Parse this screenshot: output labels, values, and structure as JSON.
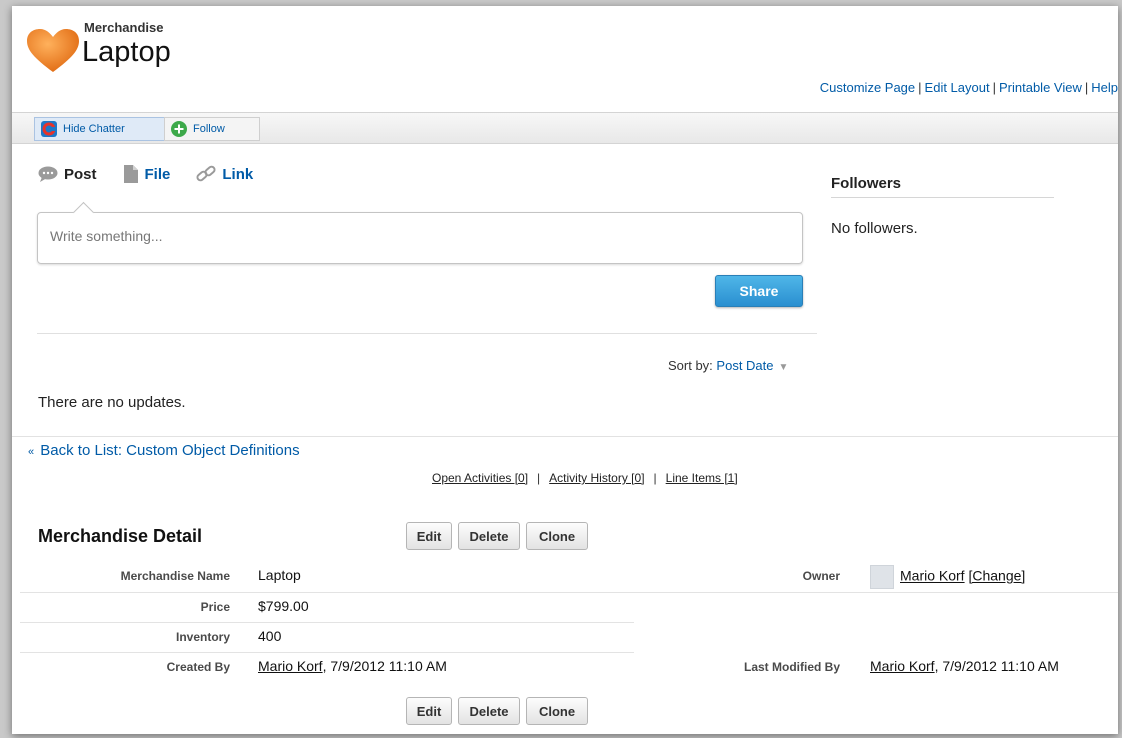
{
  "header": {
    "object_type": "Merchandise",
    "record_name": "Laptop",
    "links": [
      "Customize Page",
      "Edit Layout",
      "Printable View",
      "Help"
    ],
    "accent": "#f0892e"
  },
  "chatter": {
    "hide_label": "Hide Chatter",
    "follow_label": "Follow",
    "publisher_tabs": [
      {
        "label": "Post",
        "icon": "speech-bubble-icon"
      },
      {
        "label": "File",
        "icon": "document-icon"
      },
      {
        "label": "Link",
        "icon": "link-icon"
      }
    ],
    "input_placeholder": "Write something...",
    "share_label": "Share",
    "sort_prefix": "Sort by:",
    "sort_value": "Post Date",
    "no_updates": "There are no updates.",
    "followers_title": "Followers",
    "followers_empty": "No followers."
  },
  "nav": {
    "back_link": "Back to List: Custom Object Definitions",
    "related_links": [
      "Open Activities [0]",
      "Activity History [0]",
      "Line Items [1]"
    ]
  },
  "detail": {
    "title": "Merchandise Detail",
    "buttons": {
      "edit": "Edit",
      "delete": "Delete",
      "clone": "Clone"
    },
    "fields": {
      "name_label": "Merchandise Name",
      "name_value": "Laptop",
      "price_label": "Price",
      "price_value": "$799.00",
      "inventory_label": "Inventory",
      "inventory_value": "400",
      "created_label": "Created By",
      "created_user": "Mario Korf",
      "created_date": ", 7/9/2012 11:10 AM",
      "owner_label": "Owner",
      "owner_user": "Mario Korf",
      "owner_change": "[Change]",
      "modified_label": "Last Modified By",
      "modified_user": "Mario Korf",
      "modified_date": ", 7/9/2012 11:10 AM"
    }
  }
}
